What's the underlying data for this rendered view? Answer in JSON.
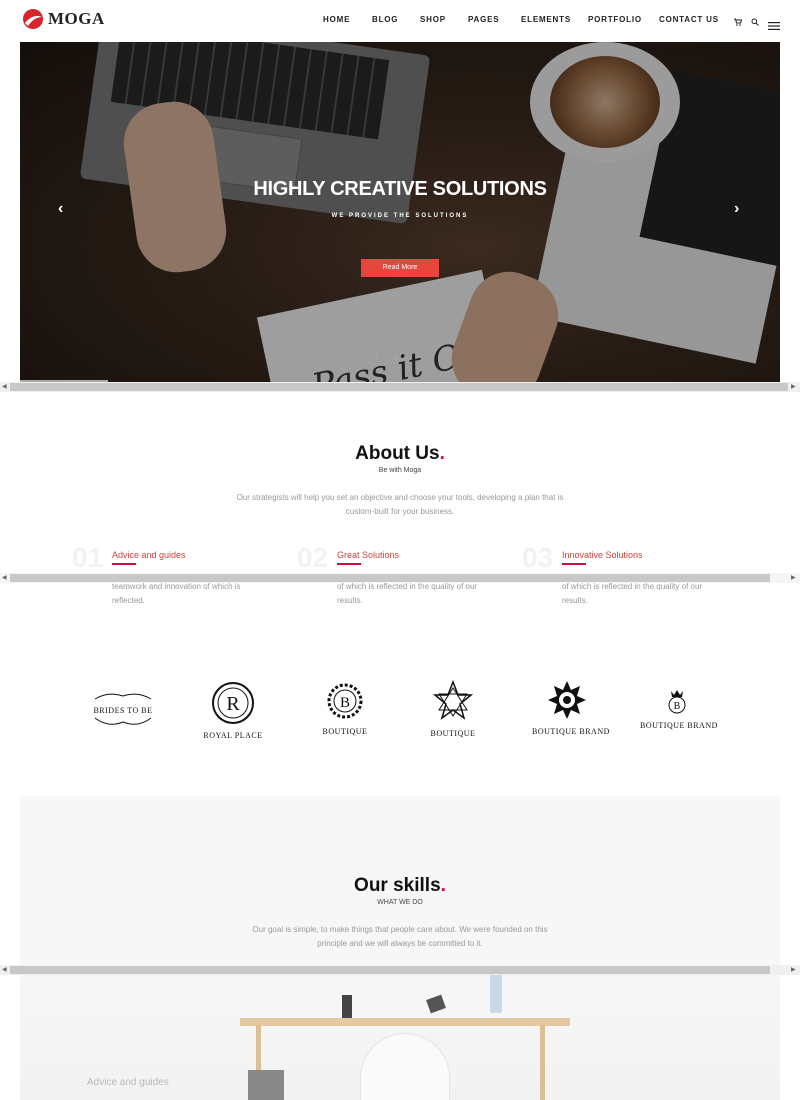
{
  "header": {
    "brand": "MOGA",
    "nav": [
      "HOME",
      "BLOG",
      "SHOP",
      "PAGES",
      "ELEMENTS",
      "PORTFOLIO",
      "CONTACT US"
    ],
    "icons": [
      "cart-icon",
      "search-icon",
      "menu-icon"
    ]
  },
  "hero": {
    "title": "HIGHLY CREATIVE SOLUTIONS",
    "subtitle": "WE PROVIDE THE SOLUTIONS",
    "button": "Read More",
    "note_script": "Pass it On",
    "prev": "‹",
    "next": "›"
  },
  "about": {
    "title": "About Us",
    "dot": ".",
    "subtitle": "Be with Moga",
    "description": "Our strategists will help you set an objective and choose your tools, developing a plan that is custom-built for your business.",
    "features": [
      {
        "num": "01",
        "title": "Advice and guides",
        "text": "teamwork and innovation of which is reflected."
      },
      {
        "num": "02",
        "title": "Great Solutions",
        "text": "of which is reflected in the quality of our results."
      },
      {
        "num": "03",
        "title": "Innovative Solutions",
        "text": "of which is reflected in the quality of our results."
      }
    ]
  },
  "brands": [
    "BRIDES TO BE",
    "ROYAL PLACE",
    "BOUTIQUE",
    "BOUTIQUE",
    "BOUTIQUE BRAND",
    "BOUTIQUE BRAND"
  ],
  "brand_letters": [
    "R",
    "B",
    "B"
  ],
  "skills": {
    "title": "Our skills",
    "dot": ".",
    "subtitle": "WHAT WE DO",
    "description": "Our goal is simple, to make things that people care about. We were founded on this principle and we will always be committed to it.",
    "faded_label": "Advice and guides"
  },
  "colors": {
    "accent": "#c8103d",
    "button": "#e8453c",
    "feature_title": "#c8443c"
  }
}
